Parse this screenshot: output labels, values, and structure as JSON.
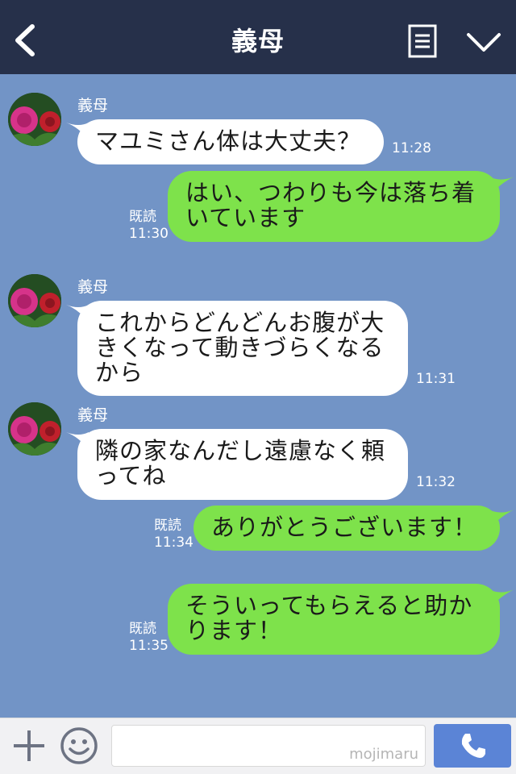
{
  "header": {
    "title": "義母",
    "back_icon": "chevron-left-icon",
    "menu_icon": "notes-icon",
    "expand_icon": "chevron-down-icon"
  },
  "messages": [
    {
      "direction": "in",
      "sender": "義母",
      "lines": [
        "マユミさん体は大丈夫？"
      ],
      "time": "11:28"
    },
    {
      "direction": "out",
      "lines": [
        "はい、つわりも今は落ち着",
        "いています"
      ],
      "read": "既読",
      "time": "11:30"
    },
    {
      "direction": "in",
      "sender": "義母",
      "lines": [
        "これからどんどんお腹が大",
        "きくなって動きづらくなる",
        "から"
      ],
      "time": "11:31"
    },
    {
      "direction": "in",
      "sender": "義母",
      "lines": [
        "隣の家なんだし遠慮なく頼",
        "ってね"
      ],
      "time": "11:32"
    },
    {
      "direction": "out",
      "lines": [
        "ありがとうございます！"
      ],
      "read": "既読",
      "time": "11:34"
    },
    {
      "direction": "out",
      "lines": [
        "そういってもらえると助か",
        "ります！"
      ],
      "read": "既読",
      "time": "11:35"
    }
  ],
  "footer": {
    "plus_icon": "plus-icon",
    "sticker_icon": "smile-icon",
    "input_value": "",
    "watermark": "mojimaru",
    "call_icon": "phone-icon"
  },
  "colors": {
    "header_bg": "#26304a",
    "chat_bg": "#7294c6",
    "incoming_bubble": "#ffffff",
    "outgoing_bubble": "#7ee24b",
    "call_button": "#5b84d6"
  }
}
